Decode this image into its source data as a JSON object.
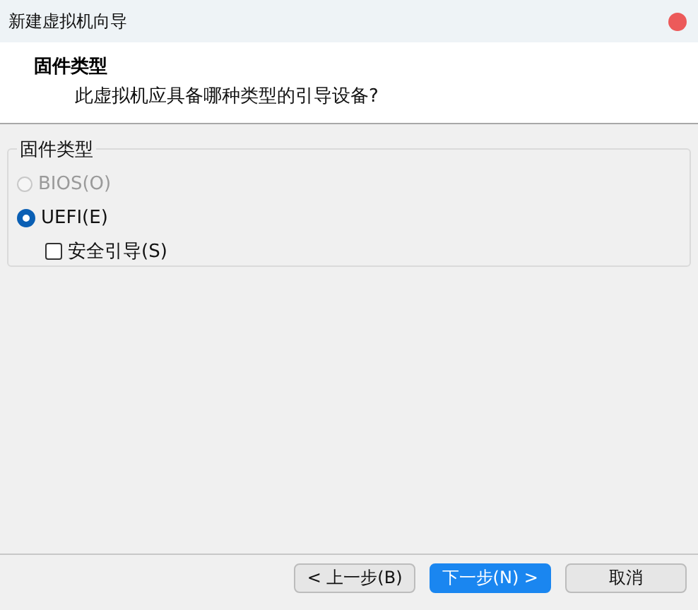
{
  "window": {
    "title": "新建虚拟机向导"
  },
  "header": {
    "title": "固件类型",
    "subtitle": "此虚拟机应具备哪种类型的引导设备?"
  },
  "group": {
    "label": "固件类型",
    "options": [
      {
        "kind": "radio",
        "label": "BIOS(O)",
        "selected": false,
        "disabled": true
      },
      {
        "kind": "radio",
        "label": "UEFI(E)",
        "selected": true,
        "disabled": false
      },
      {
        "kind": "checkbox",
        "label": "安全引导(S)",
        "checked": false,
        "disabled": false
      }
    ]
  },
  "buttons": [
    {
      "label": "< 上一步(B)",
      "primary": false
    },
    {
      "label": "下一步(N) >",
      "primary": true
    },
    {
      "label": "取消",
      "primary": false
    }
  ]
}
